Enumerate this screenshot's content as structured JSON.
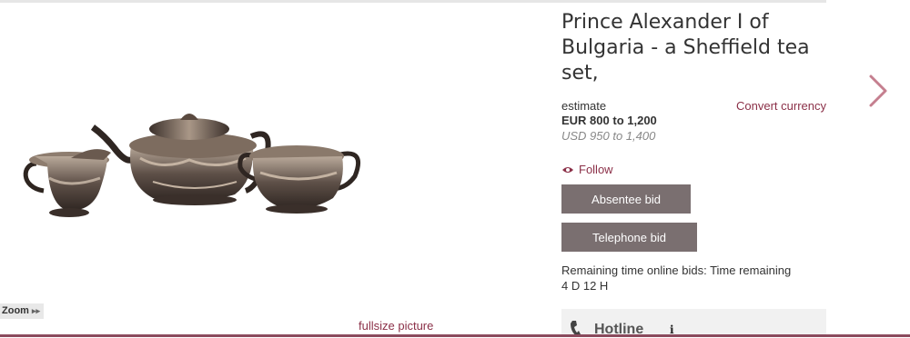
{
  "lot": {
    "title": "Prince Alexander I of Bulgaria - a Sheffield tea set,",
    "estimate_label": "estimate",
    "estimate_eur": "EUR 800 to 1,200",
    "estimate_usd": "USD 950 to 1,400",
    "convert_currency": "Convert currency"
  },
  "actions": {
    "follow": "Follow",
    "absentee_bid": "Absentee bid",
    "telephone_bid": "Telephone bid"
  },
  "remaining": {
    "label": "Remaining time online bids: Time remaining",
    "value": "4 D 12 H"
  },
  "image": {
    "zoom_label": "Zoom",
    "fullsize_link": "fullsize picture"
  },
  "hotline": {
    "label": "Hotline",
    "info": "i"
  },
  "colors": {
    "accent": "#8b3048",
    "button": "#7a6f70",
    "next_arrow": "#c57f8f"
  },
  "icons": [
    "eye-icon",
    "phone-icon",
    "info-icon",
    "chevron-right-icon",
    "double-chevron-right-icon"
  ]
}
